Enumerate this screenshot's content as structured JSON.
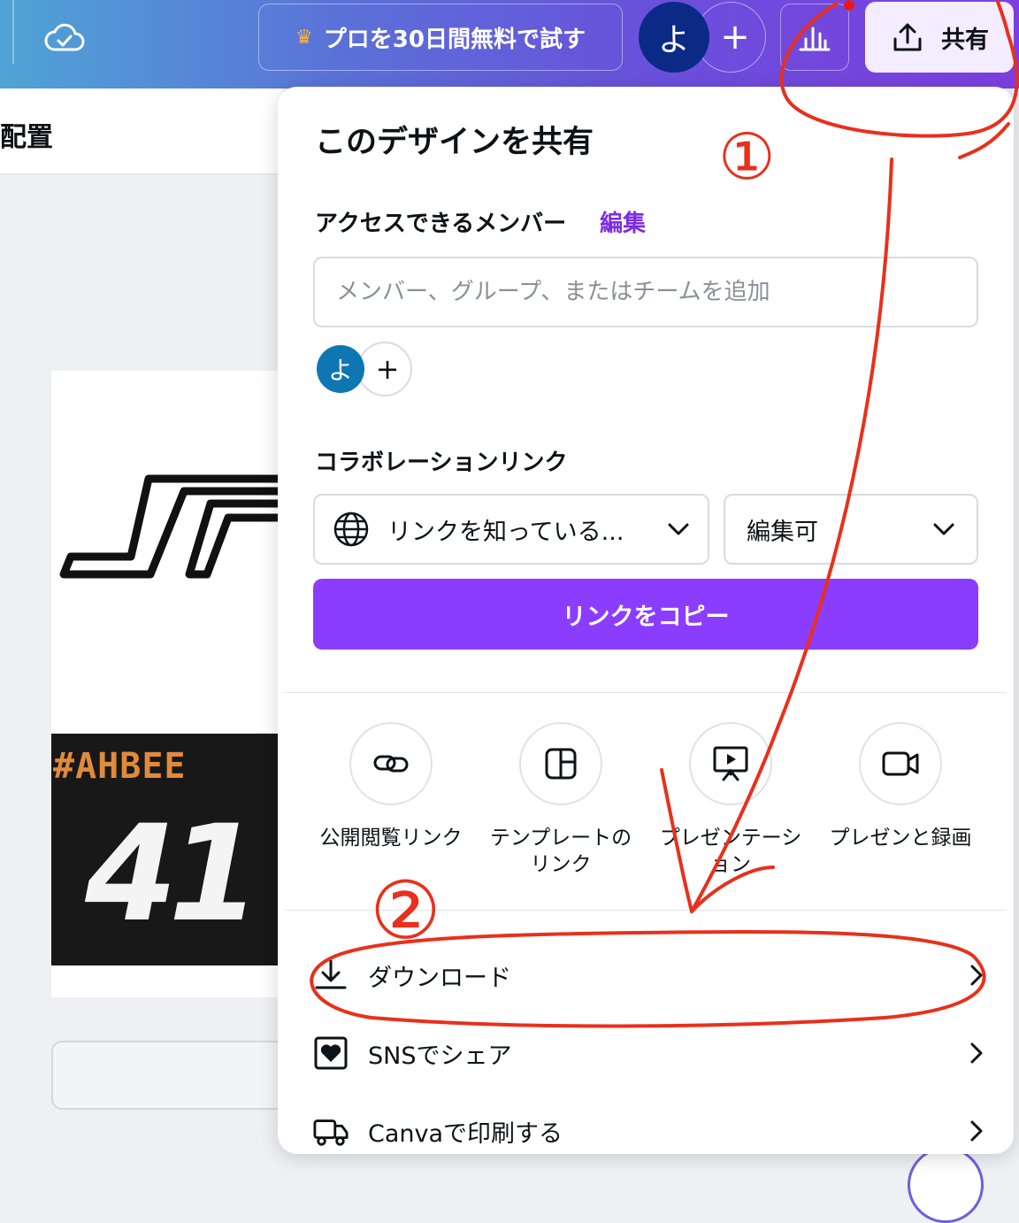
{
  "topbar": {
    "cloud_icon": "cloud-check-icon",
    "trial_label": "プロを30日間無料で試す",
    "crown_icon": "crown-icon",
    "avatar_initial": "よ",
    "add_icon": "plus-icon",
    "analytics_icon": "bar-chart-icon",
    "share_icon": "upload-icon",
    "share_label": "共有"
  },
  "editor": {
    "subbar_text": "配置",
    "sticker_text": "#AHBEE",
    "sticker_number": "41"
  },
  "share_panel": {
    "title": "このデザインを共有",
    "members_label": "アクセスできるメンバー",
    "edit_link": "編集",
    "search_placeholder": "メンバー、グループ、またはチームを追加",
    "member_avatar": "よ",
    "collab_label": "コラボレーションリンク",
    "link_access": {
      "icon": "globe-icon",
      "value": "リンクを知っている..."
    },
    "permission": {
      "value": "編集可"
    },
    "copy_button": "リンクをコピー",
    "options": [
      {
        "label": "公開閲覧リンク",
        "icon": "link-icon"
      },
      {
        "label": "テンプレートのリンク",
        "icon": "template-icon"
      },
      {
        "label": "プレゼンテーション",
        "icon": "presentation-icon"
      },
      {
        "label": "プレゼンと録画",
        "icon": "video-camera-icon"
      }
    ],
    "rows": [
      {
        "label": "ダウンロード",
        "icon": "download-icon"
      },
      {
        "label": "SNSでシェア",
        "icon": "heart-icon"
      },
      {
        "label": "Canvaで印刷する",
        "icon": "truck-icon"
      }
    ]
  },
  "annotations": {
    "step1": "①",
    "step2": "②"
  },
  "colors": {
    "accent": "#8b3dff",
    "edit_link": "#7d2ae8",
    "annotation": "#e8301c"
  }
}
